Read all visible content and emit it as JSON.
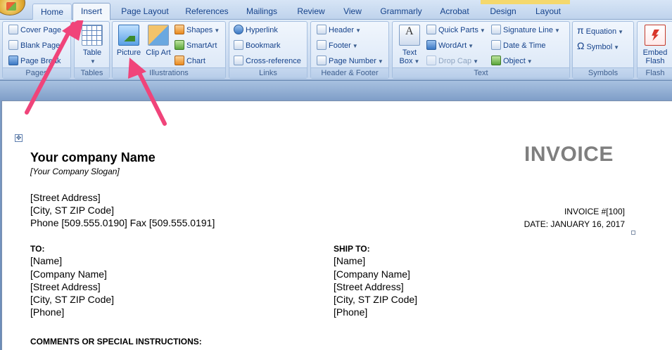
{
  "tabs": [
    {
      "label": "Home"
    },
    {
      "label": "Insert"
    },
    {
      "label": "Page Layout"
    },
    {
      "label": "References"
    },
    {
      "label": "Mailings"
    },
    {
      "label": "Review"
    },
    {
      "label": "View"
    },
    {
      "label": "Grammarly"
    },
    {
      "label": "Acrobat"
    },
    {
      "label": "Design"
    },
    {
      "label": "Layout"
    }
  ],
  "ribbon": {
    "pages": {
      "label": "Pages",
      "items": [
        "Cover Page",
        "Blank Page",
        "Page Break"
      ]
    },
    "tables": {
      "label": "Tables",
      "table": "Table"
    },
    "illustrations": {
      "label": "Illustrations",
      "picture": "Picture",
      "clip_art": "Clip Art",
      "shapes": "Shapes",
      "smartart": "SmartArt",
      "chart": "Chart"
    },
    "links": {
      "label": "Links",
      "items": [
        "Hyperlink",
        "Bookmark",
        "Cross-reference"
      ]
    },
    "header_footer": {
      "label": "Header & Footer",
      "items": [
        "Header",
        "Footer",
        "Page Number"
      ]
    },
    "text": {
      "label": "Text",
      "text_box": "Text Box",
      "quick_parts": "Quick Parts",
      "wordart": "WordArt",
      "drop_cap": "Drop Cap",
      "signature_line": "Signature Line",
      "date_time": "Date & Time",
      "object": "Object"
    },
    "symbols": {
      "label": "Symbols",
      "equation": "Equation",
      "symbol": "Symbol"
    },
    "flash": {
      "label": "Flash",
      "embed_flash": "Embed Flash"
    }
  },
  "document": {
    "company_name": "Your company  Name",
    "slogan": "[Your Company Slogan]",
    "title": "INVOICE",
    "street": "[Street Address]",
    "city": "[City, ST  ZIP Code]",
    "phone_fax": "Phone [509.555.0190]  Fax [509.555.0191]",
    "invoice_number": "INVOICE #[100]",
    "date": "DATE: JANUARY 16, 2017",
    "to": {
      "label": "TO:",
      "lines": [
        "[Name]",
        "[Company Name]",
        "[Street Address]",
        "[City, ST  ZIP Code]",
        "[Phone]"
      ]
    },
    "ship_to": {
      "label": "SHIP TO:",
      "lines": [
        "[Name]",
        "[Company Name]",
        "[Street Address]",
        "[City, ST  ZIP Code]",
        "[Phone]"
      ]
    },
    "comments_label": "COMMENTS OR SPECIAL INSTRUCTIONS:"
  },
  "colors": {
    "annotation_arrow": "#f0447a",
    "invoice_title": "#7f7f7f",
    "ribbon_text": "#15428b"
  }
}
